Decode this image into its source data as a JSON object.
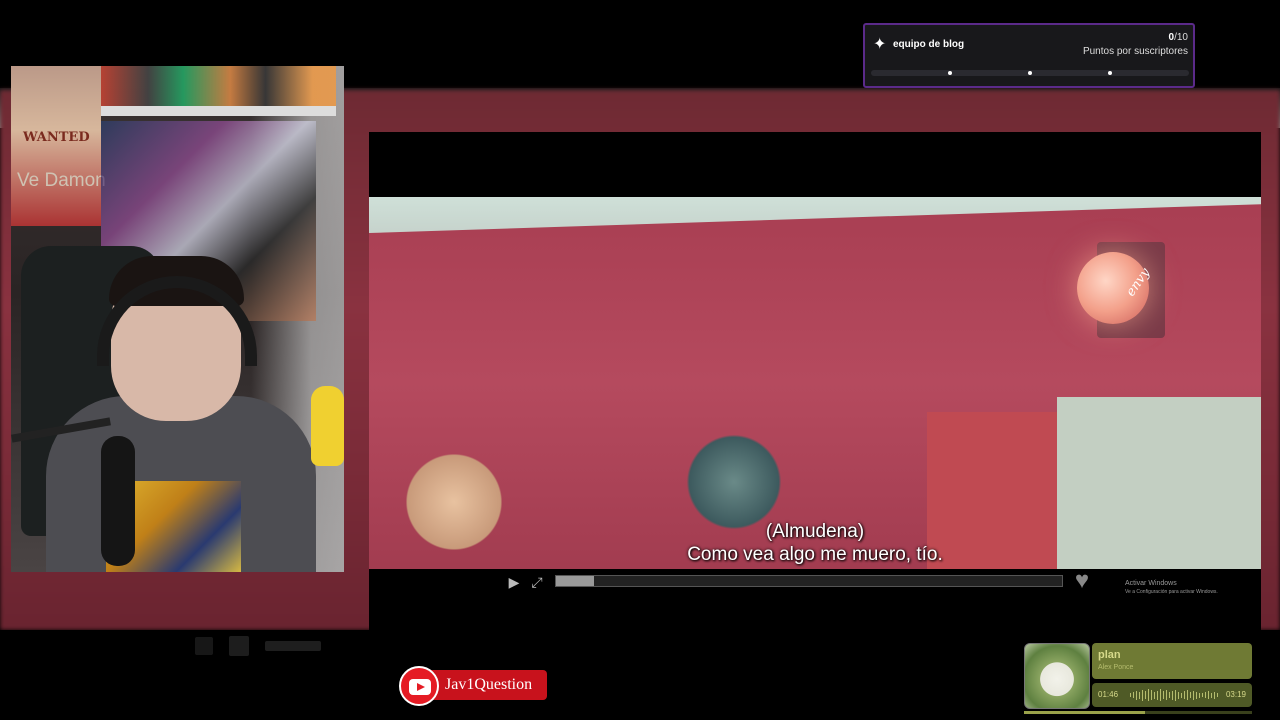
{
  "sub_goal": {
    "title": "equipo de blog",
    "current": "0",
    "target": "/10",
    "subtitle": "Puntos por suscriptores",
    "icon": "star-burst-icon",
    "progress": 0,
    "border_color": "#5b2a8a"
  },
  "player": {
    "subtitle_line1": "(Almudena)",
    "subtitle_line2": "Como vea algo me muero, tío.",
    "progress": 0.075,
    "icons": {
      "play": "play-icon",
      "fullscreen": "fullscreen-icon",
      "like": "heart-icon"
    }
  },
  "windows_notice": {
    "line1": "Activar Windows",
    "line2": "Ve a Configuración para activar Windows."
  },
  "webcam": {
    "poster_text": "WANTED",
    "poster_sub": "Ve Damon",
    "lamp_brand": "envy"
  },
  "youtube_badge": {
    "channel": "Jav1Question",
    "icon": "youtube-icon",
    "color": "#e51b24"
  },
  "music": {
    "title": "plan",
    "artist": "Alex Ponce",
    "current_time": "01:46",
    "total_time": "03:19",
    "progress": 0.53
  }
}
